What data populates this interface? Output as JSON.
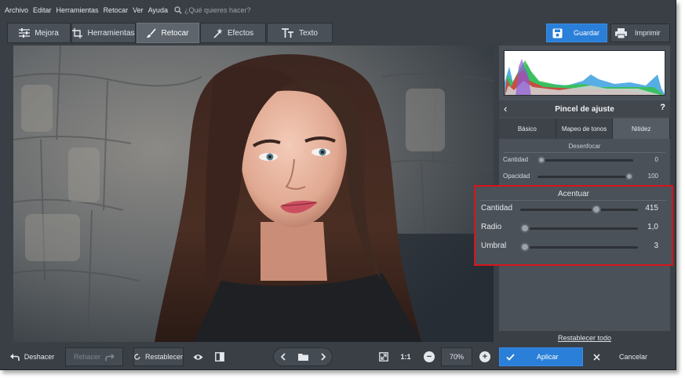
{
  "menu": {
    "items": [
      "Archivo",
      "Editar",
      "Herramientas",
      "Retocar",
      "Ver",
      "Ayuda"
    ],
    "search_placeholder": "¿Qué quieres hacer?"
  },
  "toolbar": {
    "tabs": [
      {
        "label": "Mejora",
        "icon": "sliders-icon"
      },
      {
        "label": "Herramientas",
        "icon": "crop-icon"
      },
      {
        "label": "Retocar",
        "icon": "brush-icon"
      },
      {
        "label": "Efectos",
        "icon": "magic-wand-icon"
      },
      {
        "label": "Texto",
        "icon": "text-icon"
      }
    ],
    "active_tab": "Retocar",
    "save_label": "Guardar",
    "print_label": "Imprimir"
  },
  "panel": {
    "title": "Pincel de ajuste",
    "help": "?",
    "back": "‹",
    "subtabs": [
      "Básico",
      "Mapeo de tonos",
      "Nitidez"
    ],
    "active_subtab": "Nitidez",
    "desenfocar": {
      "title": "Desenfocar",
      "sliders": [
        {
          "label": "Cantidad",
          "value": "0",
          "fraction": 0.0
        },
        {
          "label": "Opacidad",
          "value": "100",
          "fraction": 1.0
        }
      ]
    },
    "acentuar": {
      "title": "Acentuar",
      "sliders": [
        {
          "label": "Cantidad",
          "value": "415",
          "fraction": 0.66
        },
        {
          "label": "Radio",
          "value": "1,0",
          "fraction": 0.0
        },
        {
          "label": "Umbral",
          "value": "3",
          "fraction": 0.0
        }
      ]
    },
    "reset_all": "Restablecer todo"
  },
  "bottom": {
    "undo": "Deshacer",
    "redo": "Rehacer",
    "reset": "Restablecer",
    "ratio": "1:1",
    "zoom": "70%",
    "apply": "Aplicar",
    "cancel": "Cancelar"
  },
  "colors": {
    "accent": "#2a7fd8",
    "highlight_border": "#d7141b",
    "panel_bg": "#4b5158",
    "app_bg": "#3a3f45"
  }
}
